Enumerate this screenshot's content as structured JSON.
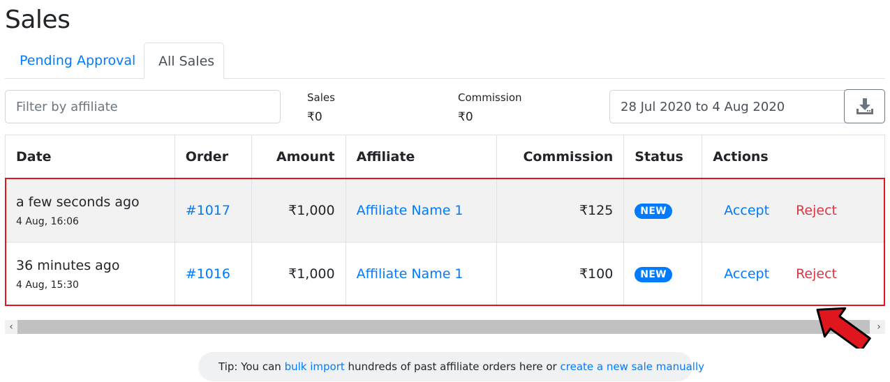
{
  "page": {
    "title": "Sales"
  },
  "tabs": [
    {
      "label": "Pending Approval",
      "active": false
    },
    {
      "label": "All Sales",
      "active": true
    }
  ],
  "filter": {
    "placeholder": "Filter by affiliate",
    "value": ""
  },
  "stats": {
    "sales_label": "Sales",
    "sales_value": "₹0",
    "commission_label": "Commission",
    "commission_value": "₹0"
  },
  "date_range": {
    "value": "28 Jul 2020 to 4 Aug 2020"
  },
  "download_button": {
    "icon": "download-icon"
  },
  "table": {
    "headers": [
      "Date",
      "Order",
      "Amount",
      "Affiliate",
      "Commission",
      "Status",
      "Actions"
    ],
    "rows": [
      {
        "relative_time": "a few seconds ago",
        "timestamp": "4 Aug, 16:06",
        "order": "#1017",
        "amount": "₹1,000",
        "affiliate": "Affiliate Name 1",
        "commission": "₹125",
        "status": "NEW",
        "accept": "Accept",
        "reject": "Reject"
      },
      {
        "relative_time": "36 minutes ago",
        "timestamp": "4 Aug, 15:30",
        "order": "#1016",
        "amount": "₹1,000",
        "affiliate": "Affiliate Name 1",
        "commission": "₹100",
        "status": "NEW",
        "accept": "Accept",
        "reject": "Reject"
      }
    ]
  },
  "scrollbar": {
    "left_arrow": "‹",
    "right_arrow": "›"
  },
  "tip": {
    "prefix": "Tip: You can ",
    "link1": "bulk import",
    "middle": " hundreds of past affiliate orders here or ",
    "link2": "create a new sale manually"
  },
  "colors": {
    "link": "#007bff",
    "danger": "#dc3545",
    "badge": "#007bff",
    "highlight": "#e0161e",
    "arrow": "#e0161e"
  }
}
